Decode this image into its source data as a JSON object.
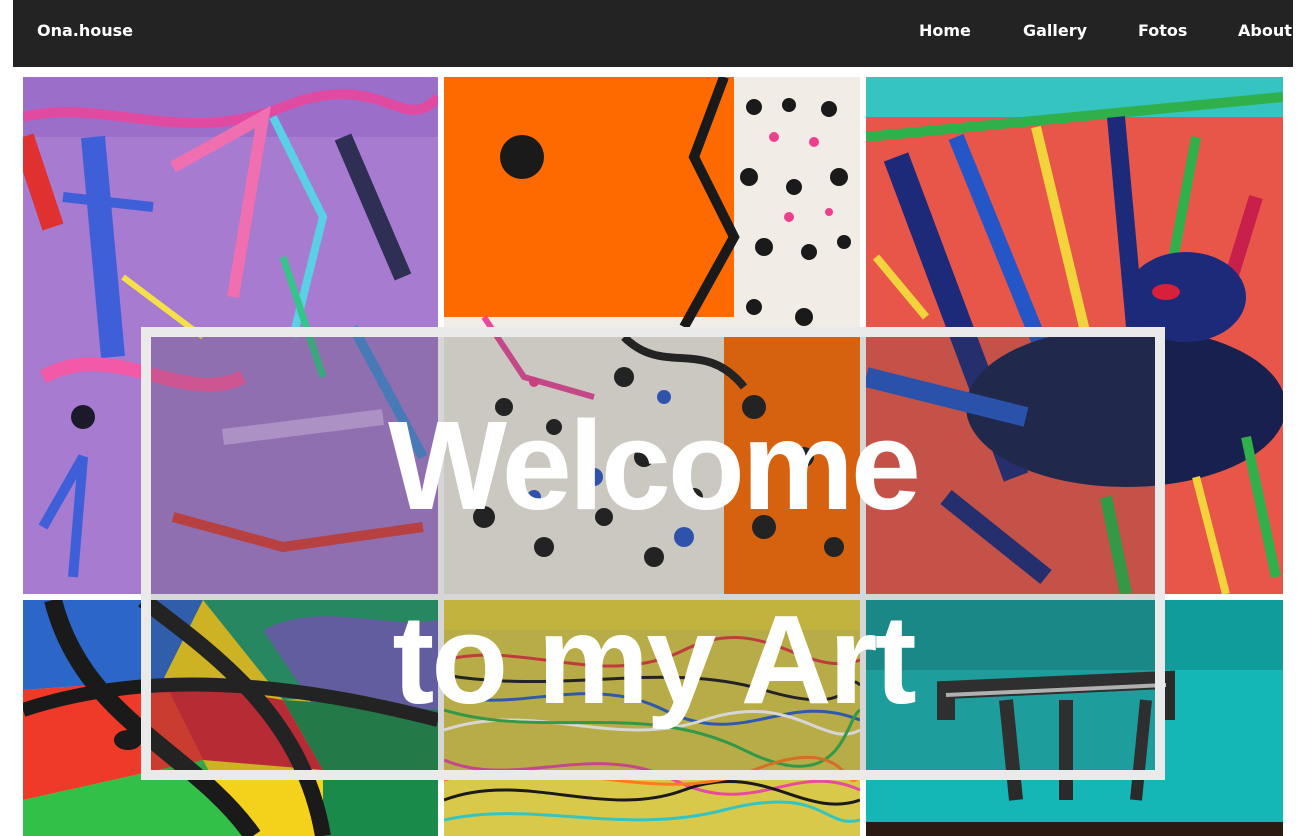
{
  "brand": "Ona.house",
  "nav": {
    "home": "Home",
    "gallery": "Gallery",
    "fotos": "Fotos",
    "about": "About"
  },
  "hero": {
    "line1": "Welcome",
    "line2": "to my Art"
  },
  "colors": {
    "navbar": "#232323",
    "frame_border": "#eaeaea",
    "hero_text": "#ffffff"
  }
}
